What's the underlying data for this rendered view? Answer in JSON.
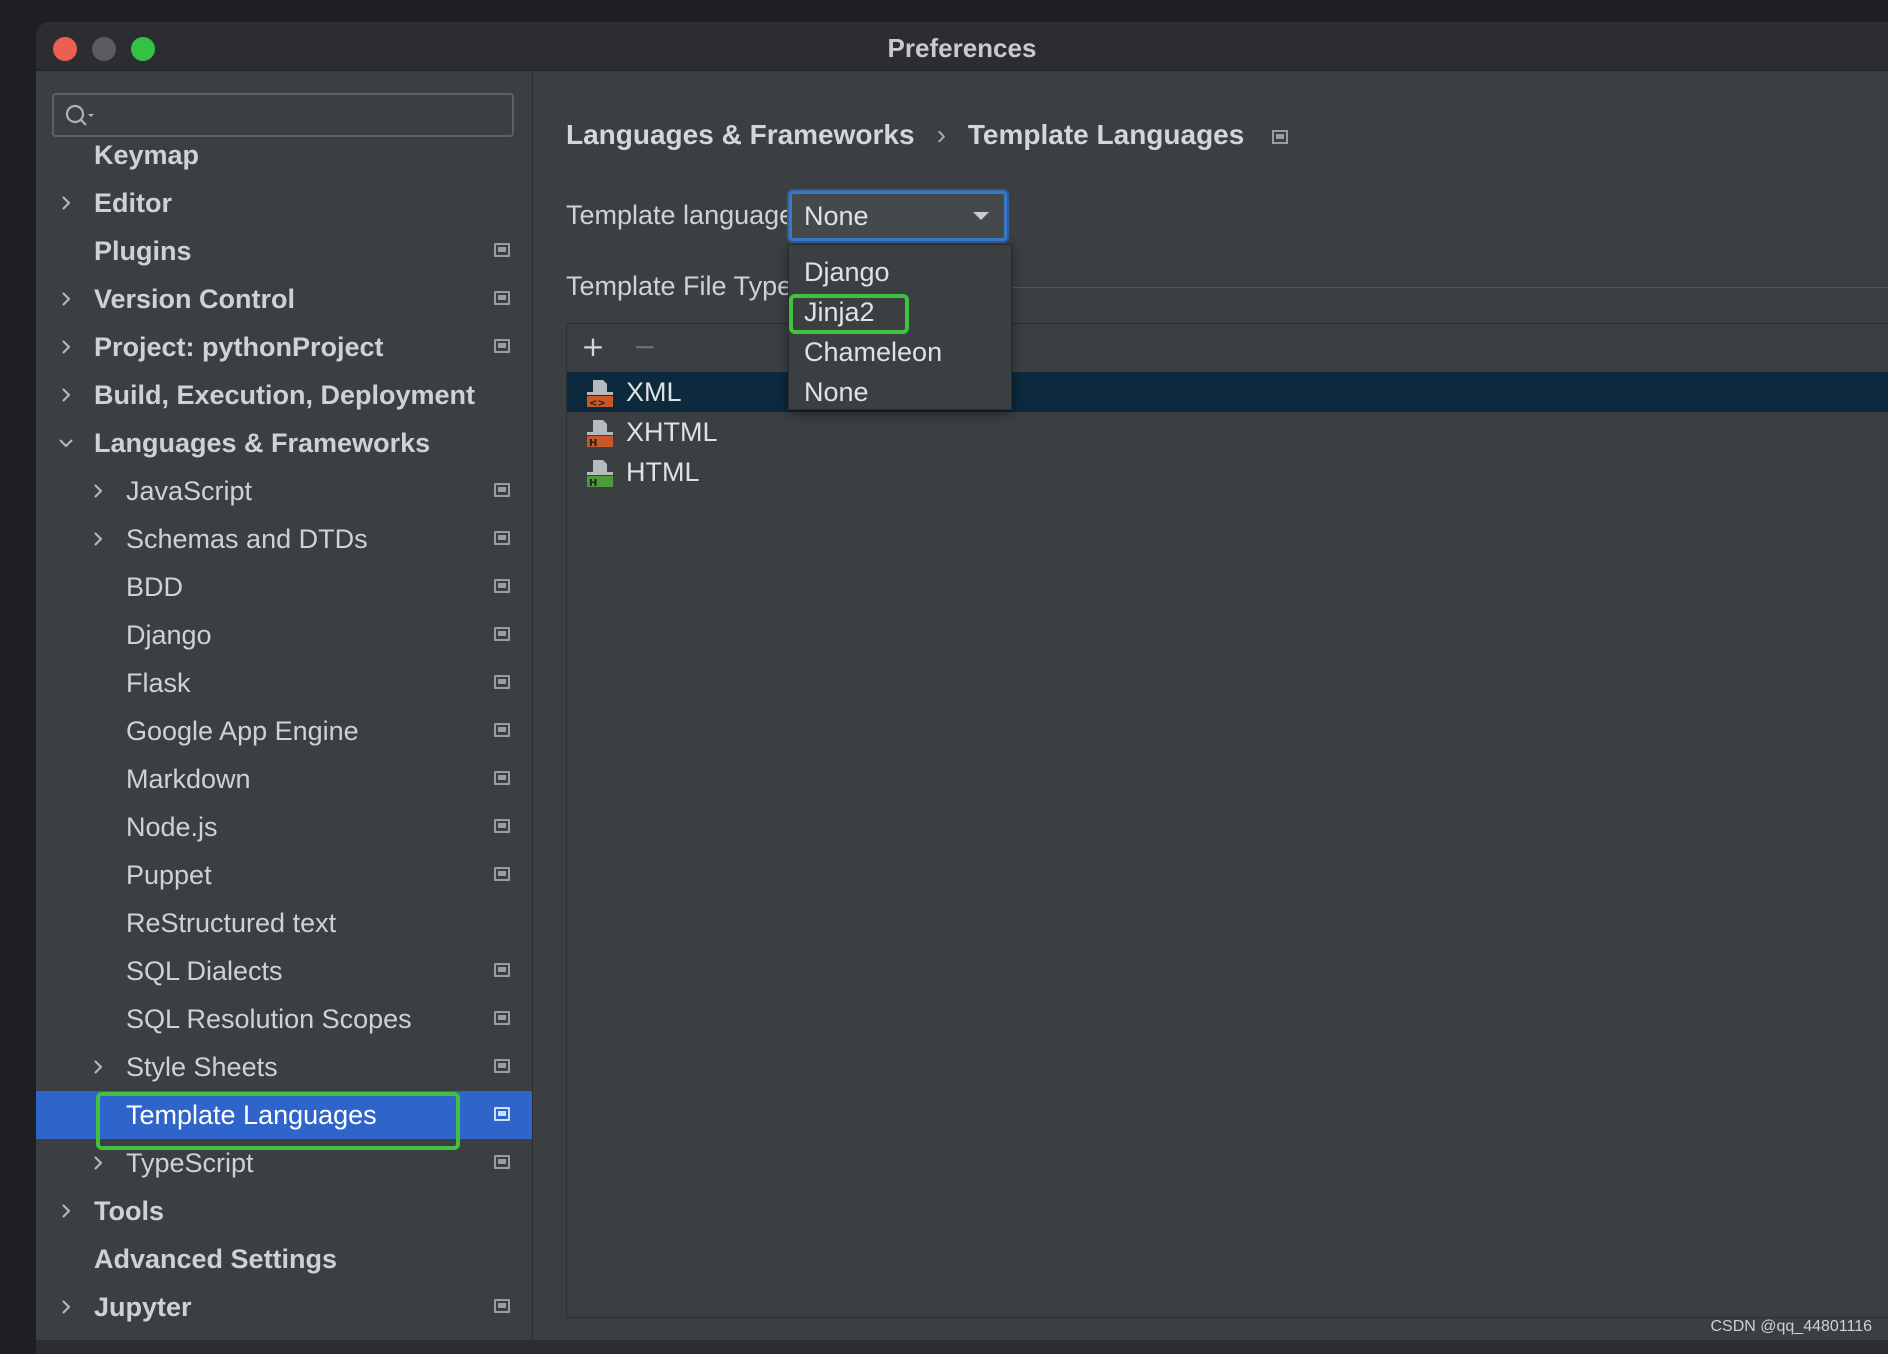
{
  "window": {
    "title": "Preferences"
  },
  "search": {
    "value": "",
    "placeholder": ""
  },
  "sidebar": {
    "items": [
      {
        "label": "Keymap",
        "level": 0,
        "bold": true,
        "expander": "none",
        "project_icon": false,
        "selected": false
      },
      {
        "label": "Editor",
        "level": 0,
        "bold": true,
        "expander": "collapsed",
        "project_icon": false,
        "selected": false
      },
      {
        "label": "Plugins",
        "level": 0,
        "bold": true,
        "expander": "none",
        "project_icon": true,
        "selected": false
      },
      {
        "label": "Version Control",
        "level": 0,
        "bold": true,
        "expander": "collapsed",
        "project_icon": true,
        "selected": false
      },
      {
        "label": "Project: pythonProject",
        "level": 0,
        "bold": true,
        "expander": "collapsed",
        "project_icon": true,
        "selected": false
      },
      {
        "label": "Build, Execution, Deployment",
        "level": 0,
        "bold": true,
        "expander": "collapsed",
        "project_icon": false,
        "selected": false
      },
      {
        "label": "Languages & Frameworks",
        "level": 0,
        "bold": true,
        "expander": "expanded",
        "project_icon": false,
        "selected": false
      },
      {
        "label": "JavaScript",
        "level": 1,
        "bold": false,
        "expander": "collapsed",
        "project_icon": true,
        "selected": false
      },
      {
        "label": "Schemas and DTDs",
        "level": 1,
        "bold": false,
        "expander": "collapsed",
        "project_icon": true,
        "selected": false
      },
      {
        "label": "BDD",
        "level": 1,
        "bold": false,
        "expander": "none",
        "project_icon": true,
        "selected": false
      },
      {
        "label": "Django",
        "level": 1,
        "bold": false,
        "expander": "none",
        "project_icon": true,
        "selected": false
      },
      {
        "label": "Flask",
        "level": 1,
        "bold": false,
        "expander": "none",
        "project_icon": true,
        "selected": false
      },
      {
        "label": "Google App Engine",
        "level": 1,
        "bold": false,
        "expander": "none",
        "project_icon": true,
        "selected": false
      },
      {
        "label": "Markdown",
        "level": 1,
        "bold": false,
        "expander": "none",
        "project_icon": true,
        "selected": false
      },
      {
        "label": "Node.js",
        "level": 1,
        "bold": false,
        "expander": "none",
        "project_icon": true,
        "selected": false
      },
      {
        "label": "Puppet",
        "level": 1,
        "bold": false,
        "expander": "none",
        "project_icon": true,
        "selected": false
      },
      {
        "label": "ReStructured text",
        "level": 1,
        "bold": false,
        "expander": "none",
        "project_icon": false,
        "selected": false
      },
      {
        "label": "SQL Dialects",
        "level": 1,
        "bold": false,
        "expander": "none",
        "project_icon": true,
        "selected": false
      },
      {
        "label": "SQL Resolution Scopes",
        "level": 1,
        "bold": false,
        "expander": "none",
        "project_icon": true,
        "selected": false
      },
      {
        "label": "Style Sheets",
        "level": 1,
        "bold": false,
        "expander": "collapsed",
        "project_icon": true,
        "selected": false
      },
      {
        "label": "Template Languages",
        "level": 1,
        "bold": false,
        "expander": "none",
        "project_icon": true,
        "selected": true
      },
      {
        "label": "TypeScript",
        "level": 1,
        "bold": false,
        "expander": "collapsed",
        "project_icon": true,
        "selected": false
      },
      {
        "label": "Tools",
        "level": 0,
        "bold": true,
        "expander": "collapsed",
        "project_icon": false,
        "selected": false
      },
      {
        "label": "Advanced Settings",
        "level": 0,
        "bold": true,
        "expander": "none",
        "project_icon": false,
        "selected": false
      },
      {
        "label": "Jupyter",
        "level": 0,
        "bold": true,
        "expander": "collapsed",
        "project_icon": true,
        "selected": false
      }
    ]
  },
  "breadcrumb": {
    "parent": "Languages & Frameworks",
    "separator": "›",
    "current": "Template Languages"
  },
  "template_language": {
    "label": "Template language:",
    "selected": "None",
    "options": [
      "Django",
      "Jinja2",
      "Chameleon",
      "None"
    ],
    "highlighted_option": "Jinja2"
  },
  "file_types": {
    "label": "Template File Types",
    "add_label": "+",
    "remove_label": "−",
    "items": [
      {
        "label": "XML",
        "icon": "xml-file-icon",
        "badge": "<>",
        "badge_color": "#c8572a",
        "selected": true
      },
      {
        "label": "XHTML",
        "icon": "xhtml-file-icon",
        "badge": "H",
        "badge_color": "#c8572a",
        "selected": false
      },
      {
        "label": "HTML",
        "icon": "html-file-icon",
        "badge": "H",
        "badge_color": "#4e9a3a",
        "selected": false
      }
    ]
  },
  "watermark": "CSDN @qq_44801116",
  "colors": {
    "accent": "#2f65ca",
    "highlight": "#3ec23f",
    "background": "#3c3f41",
    "selected_row": "#0d293e"
  }
}
